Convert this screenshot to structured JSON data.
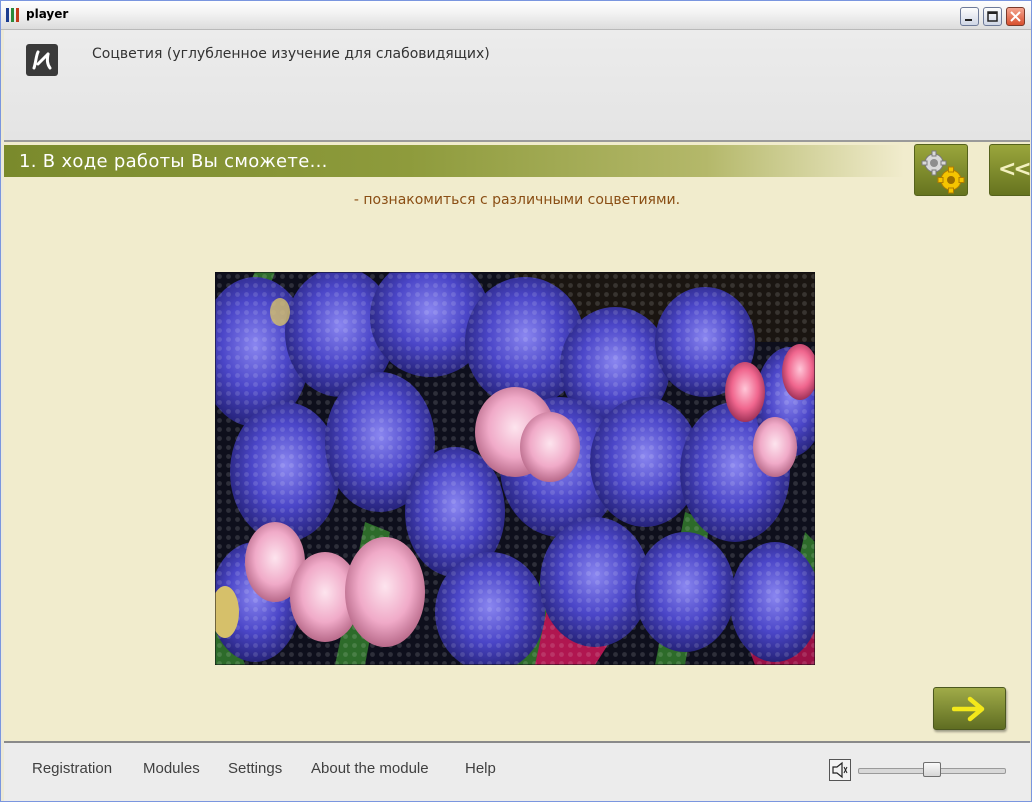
{
  "window": {
    "title": "player",
    "buttons": {
      "minimize": "minimize-icon",
      "maximize": "maximize-icon",
      "close": "close-icon"
    }
  },
  "header": {
    "logo_icon": "course-logo-icon",
    "course_title": "Соцветия (углубленное изучение для слабовидящих)"
  },
  "section": {
    "title": "1. В ходе работы Вы сможете...",
    "settings_icon": "gears-icon",
    "collapse_label": "<<",
    "objective": "- познакомиться с различными соцветиями.",
    "image_subject": "hyacinths-photo",
    "next_icon": "arrow-right-icon"
  },
  "footer": {
    "menu": [
      "Registration",
      "Modules",
      "Settings",
      "About the module",
      "Help"
    ],
    "volume_icon": "speaker-icon",
    "volume_level": 0.5
  },
  "colors": {
    "accent_green": "#7a8a2c",
    "content_bg": "#f1eccd",
    "objective_text": "#8a4e14",
    "arrow_yellow": "#f3e81a"
  }
}
